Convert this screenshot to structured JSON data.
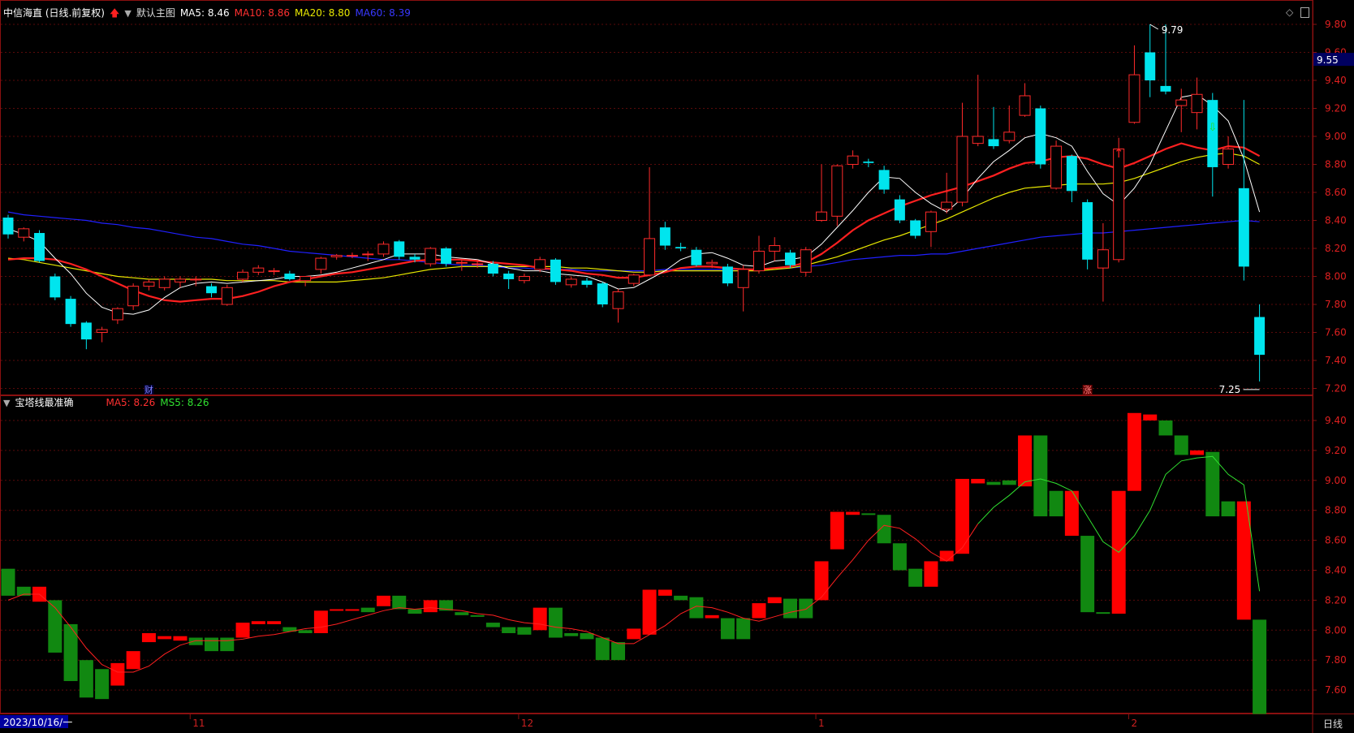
{
  "top_header": {
    "stock": "中信海直 (日线.前复权)",
    "main_label": "默认主图",
    "ma5": "MA5: 8.46",
    "ma10": "MA10: 8.86",
    "ma20": "MA20: 8.80",
    "ma60": "MA60: 8.39"
  },
  "bottom_header": {
    "indicator": "宝塔线最准确",
    "ma5": "MA5: 8.26",
    "ms5": "MS5: 8.26"
  },
  "markers": {
    "high_label": "9.79",
    "low_label": "7.25",
    "cai": "财",
    "zhang": "涨",
    "current_price": "9.55"
  },
  "x_axis": {
    "date_box": "2023/10/16/一",
    "ticks": [
      "11",
      "12",
      "1",
      "2"
    ],
    "period": "日线"
  },
  "colors": {
    "up": "#ff2a2a",
    "down": "#00e5ee",
    "ma5": "#ffffff",
    "ma10": "#ff2020",
    "ma20": "#e8e800",
    "ma60": "#2020ff",
    "tower_up": "#ff0000",
    "tower_down": "#118811"
  },
  "chart_data": [
    {
      "type": "candlestick",
      "title": "中信海直 (日线.前复权)",
      "y_ticks": [
        9.8,
        9.6,
        9.4,
        9.2,
        9.0,
        8.8,
        8.6,
        8.4,
        8.2,
        8.0,
        7.8,
        7.6,
        7.4,
        7.2
      ],
      "ylim": [
        7.1,
        9.9
      ],
      "ohlc": [
        [
          8.42,
          8.3,
          8.44,
          8.27
        ],
        [
          8.28,
          8.34,
          8.35,
          8.25
        ],
        [
          8.31,
          8.11,
          8.33,
          8.1
        ],
        [
          8.0,
          7.85,
          8.02,
          7.83
        ],
        [
          7.84,
          7.66,
          7.86,
          7.64
        ],
        [
          7.67,
          7.55,
          7.68,
          7.48
        ],
        [
          7.6,
          7.62,
          7.64,
          7.53
        ],
        [
          7.69,
          7.77,
          7.78,
          7.66
        ],
        [
          7.79,
          7.93,
          7.95,
          7.76
        ],
        [
          7.93,
          7.96,
          7.98,
          7.9
        ],
        [
          7.92,
          7.98,
          8.0,
          7.9
        ],
        [
          7.96,
          7.98,
          8.0,
          7.92
        ],
        [
          7.98,
          7.98,
          8.0,
          7.93
        ],
        [
          7.93,
          7.88,
          7.95,
          7.85
        ],
        [
          7.8,
          7.92,
          7.94,
          7.79
        ],
        [
          7.98,
          8.03,
          8.05,
          7.96
        ],
        [
          8.03,
          8.06,
          8.08,
          8.01
        ],
        [
          8.04,
          8.04,
          8.06,
          8.01
        ],
        [
          8.02,
          7.98,
          8.04,
          7.97
        ],
        [
          7.97,
          8.0,
          8.0,
          7.93
        ],
        [
          8.05,
          8.13,
          8.14,
          8.02
        ],
        [
          8.14,
          8.15,
          8.16,
          8.12
        ],
        [
          8.15,
          8.15,
          8.17,
          8.13
        ],
        [
          8.16,
          8.16,
          8.18,
          8.11
        ],
        [
          8.16,
          8.23,
          8.25,
          8.14
        ],
        [
          8.25,
          8.14,
          8.26,
          8.12
        ],
        [
          8.14,
          8.12,
          8.16,
          8.1
        ],
        [
          8.09,
          8.2,
          8.21,
          8.07
        ],
        [
          8.2,
          8.09,
          8.21,
          8.07
        ],
        [
          8.1,
          8.1,
          8.12,
          8.04
        ],
        [
          8.09,
          8.09,
          8.12,
          8.06
        ],
        [
          8.09,
          8.02,
          8.11,
          8.0
        ],
        [
          8.02,
          7.98,
          8.04,
          7.91
        ],
        [
          7.97,
          8.0,
          8.02,
          7.95
        ],
        [
          8.05,
          8.12,
          8.14,
          8.03
        ],
        [
          8.12,
          7.96,
          8.13,
          7.94
        ],
        [
          7.94,
          7.98,
          8.0,
          7.92
        ],
        [
          7.97,
          7.94,
          7.99,
          7.92
        ],
        [
          7.95,
          7.8,
          7.96,
          7.78
        ],
        [
          7.77,
          7.89,
          7.91,
          7.67
        ],
        [
          7.95,
          8.01,
          8.02,
          7.93
        ],
        [
          8.01,
          8.27,
          8.78,
          8.0
        ],
        [
          8.35,
          8.22,
          8.39,
          8.19
        ],
        [
          8.21,
          8.2,
          8.24,
          8.18
        ],
        [
          8.19,
          8.08,
          8.21,
          8.07
        ],
        [
          8.09,
          8.1,
          8.12,
          8.06
        ],
        [
          8.07,
          7.95,
          8.09,
          7.93
        ],
        [
          7.92,
          8.05,
          8.08,
          7.75
        ],
        [
          8.04,
          8.18,
          8.29,
          8.02
        ],
        [
          8.18,
          8.22,
          8.28,
          8.11
        ],
        [
          8.17,
          8.08,
          8.19,
          8.06
        ],
        [
          8.03,
          8.19,
          8.21,
          8.0
        ],
        [
          8.4,
          8.46,
          8.8,
          8.39
        ],
        [
          8.43,
          8.79,
          8.8,
          8.36
        ],
        [
          8.8,
          8.86,
          8.9,
          8.77
        ],
        [
          8.82,
          8.81,
          8.84,
          8.78
        ],
        [
          8.76,
          8.62,
          8.79,
          8.59
        ],
        [
          8.55,
          8.4,
          8.58,
          8.38
        ],
        [
          8.4,
          8.29,
          8.41,
          8.27
        ],
        [
          8.32,
          8.46,
          8.47,
          8.21
        ],
        [
          8.48,
          8.53,
          8.74,
          8.45
        ],
        [
          8.53,
          9.0,
          9.24,
          8.5
        ],
        [
          8.95,
          9.0,
          9.44,
          8.93
        ],
        [
          8.98,
          8.93,
          9.21,
          8.91
        ],
        [
          8.97,
          9.03,
          9.22,
          8.95
        ],
        [
          9.15,
          9.29,
          9.38,
          9.14
        ],
        [
          9.2,
          8.8,
          9.22,
          8.77
        ],
        [
          8.63,
          8.93,
          8.97,
          8.62
        ],
        [
          8.86,
          8.61,
          8.87,
          8.53
        ],
        [
          8.53,
          8.12,
          8.55,
          8.05
        ],
        [
          8.06,
          8.19,
          8.38,
          7.82
        ],
        [
          8.12,
          8.91,
          8.99,
          8.1
        ],
        [
          9.1,
          9.44,
          9.65,
          9.09
        ],
        [
          9.6,
          9.4,
          9.8,
          9.28
        ],
        [
          9.36,
          9.32,
          9.8,
          9.3
        ],
        [
          9.22,
          9.26,
          9.34,
          9.03
        ],
        [
          9.17,
          9.3,
          9.42,
          9.05
        ],
        [
          9.26,
          8.78,
          9.31,
          8.57
        ],
        [
          8.8,
          8.91,
          9.0,
          8.77
        ],
        [
          8.63,
          8.07,
          9.26,
          7.97
        ],
        [
          7.71,
          7.44,
          7.8,
          7.25
        ]
      ],
      "ma5": [
        8.34,
        8.3,
        8.25,
        8.13,
        8.02,
        7.88,
        7.78,
        7.74,
        7.73,
        7.76,
        7.85,
        7.92,
        7.95,
        7.96,
        7.95,
        7.96,
        7.97,
        7.98,
        8.0,
        8.0,
        8.01,
        8.03,
        8.06,
        8.09,
        8.12,
        8.16,
        8.16,
        8.16,
        8.14,
        8.13,
        8.12,
        8.09,
        8.06,
        8.04,
        8.04,
        8.02,
        8.01,
        8.0,
        7.96,
        7.91,
        7.92,
        7.98,
        8.04,
        8.12,
        8.16,
        8.17,
        8.13,
        8.08,
        8.07,
        8.11,
        8.12,
        8.14,
        8.23,
        8.35,
        8.47,
        8.6,
        8.71,
        8.7,
        8.6,
        8.52,
        8.46,
        8.56,
        8.7,
        8.82,
        8.9,
        8.99,
        9.02,
        8.99,
        8.93,
        8.75,
        8.59,
        8.51,
        8.63,
        8.8,
        9.04,
        9.28,
        9.3,
        9.22,
        9.11,
        8.84,
        8.46
      ],
      "ma10": [
        8.12,
        8.13,
        8.13,
        8.12,
        8.09,
        8.05,
        8.0,
        7.95,
        7.9,
        7.86,
        7.83,
        7.82,
        7.83,
        7.84,
        7.84,
        7.86,
        7.89,
        7.93,
        7.96,
        7.98,
        8.0,
        8.02,
        8.03,
        8.05,
        8.07,
        8.09,
        8.11,
        8.12,
        8.12,
        8.12,
        8.11,
        8.1,
        8.09,
        8.08,
        8.06,
        8.05,
        8.04,
        8.02,
        8.01,
        7.99,
        7.99,
        8.01,
        8.03,
        8.06,
        8.07,
        8.07,
        8.06,
        8.05,
        8.05,
        8.06,
        8.07,
        8.1,
        8.16,
        8.24,
        8.33,
        8.4,
        8.45,
        8.5,
        8.54,
        8.58,
        8.61,
        8.64,
        8.68,
        8.72,
        8.77,
        8.81,
        8.82,
        8.85,
        8.86,
        8.84,
        8.8,
        8.77,
        8.81,
        8.86,
        8.91,
        8.95,
        8.92,
        8.9,
        8.93,
        8.92,
        8.86
      ],
      "ma20": [
        8.13,
        8.12,
        8.1,
        8.08,
        8.06,
        8.04,
        8.02,
        8.0,
        7.99,
        7.98,
        7.98,
        7.98,
        7.98,
        7.98,
        7.97,
        7.97,
        7.97,
        7.97,
        7.96,
        7.96,
        7.96,
        7.96,
        7.97,
        7.98,
        7.99,
        8.01,
        8.03,
        8.05,
        8.06,
        8.07,
        8.07,
        8.07,
        8.07,
        8.07,
        8.07,
        8.07,
        8.06,
        8.06,
        8.05,
        8.04,
        8.03,
        8.03,
        8.04,
        8.04,
        8.04,
        8.04,
        8.04,
        8.04,
        8.04,
        8.05,
        8.06,
        8.08,
        8.11,
        8.14,
        8.18,
        8.22,
        8.26,
        8.29,
        8.33,
        8.37,
        8.41,
        8.46,
        8.51,
        8.56,
        8.6,
        8.63,
        8.64,
        8.65,
        8.66,
        8.66,
        8.66,
        8.67,
        8.7,
        8.74,
        8.78,
        8.82,
        8.85,
        8.87,
        8.88,
        8.86,
        8.8
      ],
      "ma60": [
        8.46,
        8.44,
        8.43,
        8.42,
        8.41,
        8.4,
        8.38,
        8.37,
        8.35,
        8.34,
        8.32,
        8.3,
        8.28,
        8.27,
        8.25,
        8.23,
        8.22,
        8.2,
        8.18,
        8.17,
        8.16,
        8.15,
        8.14,
        8.13,
        8.12,
        8.12,
        8.11,
        8.1,
        8.09,
        8.08,
        8.08,
        8.07,
        8.06,
        8.06,
        8.05,
        8.05,
        8.05,
        8.04,
        8.04,
        8.04,
        8.04,
        8.04,
        8.05,
        8.05,
        8.05,
        8.05,
        8.05,
        8.05,
        8.05,
        8.06,
        8.06,
        8.07,
        8.08,
        8.1,
        8.12,
        8.13,
        8.14,
        8.15,
        8.15,
        8.16,
        8.16,
        8.18,
        8.2,
        8.22,
        8.24,
        8.26,
        8.28,
        8.29,
        8.3,
        8.31,
        8.31,
        8.32,
        8.33,
        8.34,
        8.35,
        8.36,
        8.37,
        8.38,
        8.39,
        8.4,
        8.39
      ]
    },
    {
      "type": "bar",
      "title": "宝塔线最准确",
      "y_ticks": [
        9.4,
        9.2,
        9.0,
        8.8,
        8.6,
        8.4,
        8.2,
        8.0,
        7.8,
        7.6
      ],
      "ylim": [
        7.46,
        9.52
      ],
      "tower": [
        [
          8.41,
          8.23,
          "down"
        ],
        [
          8.29,
          8.23,
          "down"
        ],
        [
          8.29,
          8.19,
          "up"
        ],
        [
          8.2,
          7.85,
          "down"
        ],
        [
          8.04,
          7.66,
          "down"
        ],
        [
          7.8,
          7.55,
          "down"
        ],
        [
          7.74,
          7.54,
          "down"
        ],
        [
          7.78,
          7.63,
          "up"
        ],
        [
          7.86,
          7.74,
          "up"
        ],
        [
          7.98,
          7.92,
          "up"
        ],
        [
          7.96,
          7.94,
          "up"
        ],
        [
          7.96,
          7.93,
          "up"
        ],
        [
          7.95,
          7.9,
          "down"
        ],
        [
          7.95,
          7.86,
          "down"
        ],
        [
          7.95,
          7.86,
          "down"
        ],
        [
          8.05,
          7.95,
          "up"
        ],
        [
          8.06,
          8.04,
          "up"
        ],
        [
          8.06,
          8.04,
          "up"
        ],
        [
          8.02,
          7.99,
          "down"
        ],
        [
          8.0,
          7.98,
          "down"
        ],
        [
          8.13,
          7.98,
          "up"
        ],
        [
          8.14,
          8.13,
          "up"
        ],
        [
          8.14,
          8.13,
          "up"
        ],
        [
          8.15,
          8.12,
          "down"
        ],
        [
          8.23,
          8.16,
          "up"
        ],
        [
          8.23,
          8.14,
          "down"
        ],
        [
          8.14,
          8.11,
          "down"
        ],
        [
          8.2,
          8.12,
          "up"
        ],
        [
          8.2,
          8.13,
          "down"
        ],
        [
          8.12,
          8.1,
          "down"
        ],
        [
          8.1,
          8.1,
          "down"
        ],
        [
          8.05,
          8.02,
          "down"
        ],
        [
          8.02,
          7.98,
          "down"
        ],
        [
          8.02,
          7.97,
          "down"
        ],
        [
          8.15,
          8.0,
          "up"
        ],
        [
          8.15,
          7.95,
          "down"
        ],
        [
          7.98,
          7.96,
          "down"
        ],
        [
          7.98,
          7.94,
          "down"
        ],
        [
          7.95,
          7.8,
          "down"
        ],
        [
          7.92,
          7.8,
          "down"
        ],
        [
          8.01,
          7.94,
          "up"
        ],
        [
          8.27,
          7.97,
          "up"
        ],
        [
          8.27,
          8.23,
          "up"
        ],
        [
          8.23,
          8.2,
          "down"
        ],
        [
          8.22,
          8.08,
          "down"
        ],
        [
          8.1,
          8.08,
          "up"
        ],
        [
          8.08,
          7.94,
          "down"
        ],
        [
          8.08,
          7.94,
          "down"
        ],
        [
          8.18,
          8.08,
          "up"
        ],
        [
          8.22,
          8.18,
          "up"
        ],
        [
          8.21,
          8.08,
          "down"
        ],
        [
          8.21,
          8.08,
          "down"
        ],
        [
          8.46,
          8.2,
          "up"
        ],
        [
          8.79,
          8.54,
          "up"
        ],
        [
          8.79,
          8.77,
          "up"
        ],
        [
          8.78,
          8.77,
          "down"
        ],
        [
          8.77,
          8.58,
          "down"
        ],
        [
          8.58,
          8.4,
          "down"
        ],
        [
          8.41,
          8.29,
          "down"
        ],
        [
          8.46,
          8.29,
          "up"
        ],
        [
          8.53,
          8.46,
          "up"
        ],
        [
          9.01,
          8.51,
          "up"
        ],
        [
          9.01,
          8.98,
          "up"
        ],
        [
          8.99,
          8.97,
          "down"
        ],
        [
          9.0,
          8.97,
          "down"
        ],
        [
          9.3,
          8.96,
          "up"
        ],
        [
          9.3,
          8.76,
          "down"
        ],
        [
          8.93,
          8.76,
          "down"
        ],
        [
          8.93,
          8.63,
          "up"
        ],
        [
          8.63,
          8.12,
          "down"
        ],
        [
          8.12,
          8.11,
          "down"
        ],
        [
          8.93,
          8.11,
          "up"
        ],
        [
          9.45,
          8.93,
          "up"
        ],
        [
          9.44,
          9.4,
          "up"
        ],
        [
          9.4,
          9.3,
          "down"
        ],
        [
          9.3,
          9.17,
          "down"
        ],
        [
          9.2,
          9.17,
          "up"
        ],
        [
          9.19,
          8.76,
          "down"
        ],
        [
          8.86,
          8.76,
          "down"
        ],
        [
          8.86,
          8.07,
          "up"
        ],
        [
          8.07,
          7.44,
          "down"
        ]
      ],
      "ma5": [
        8.2,
        8.24,
        8.24,
        8.15,
        8.02,
        7.88,
        7.77,
        7.72,
        7.72,
        7.76,
        7.84,
        7.9,
        7.93,
        7.93,
        7.93,
        7.94,
        7.96,
        7.97,
        7.99,
        8.01,
        8.02,
        8.04,
        8.07,
        8.1,
        8.13,
        8.15,
        8.14,
        8.15,
        8.14,
        8.13,
        8.11,
        8.1,
        8.07,
        8.05,
        8.04,
        8.02,
        8.01,
        7.99,
        7.95,
        7.91,
        7.91,
        7.97,
        8.03,
        8.11,
        8.16,
        8.15,
        8.12,
        8.08,
        8.06,
        8.09,
        8.12,
        8.14,
        8.22,
        8.35,
        8.47,
        8.6,
        8.7,
        8.68,
        8.61,
        8.52,
        8.46,
        8.55,
        8.71,
        8.82,
        8.9,
        8.99,
        9.01,
        8.98,
        8.93,
        8.76,
        8.59,
        8.52,
        8.63,
        8.8,
        9.04,
        9.13,
        9.15,
        9.16,
        9.04,
        8.97,
        8.26
      ]
    }
  ]
}
